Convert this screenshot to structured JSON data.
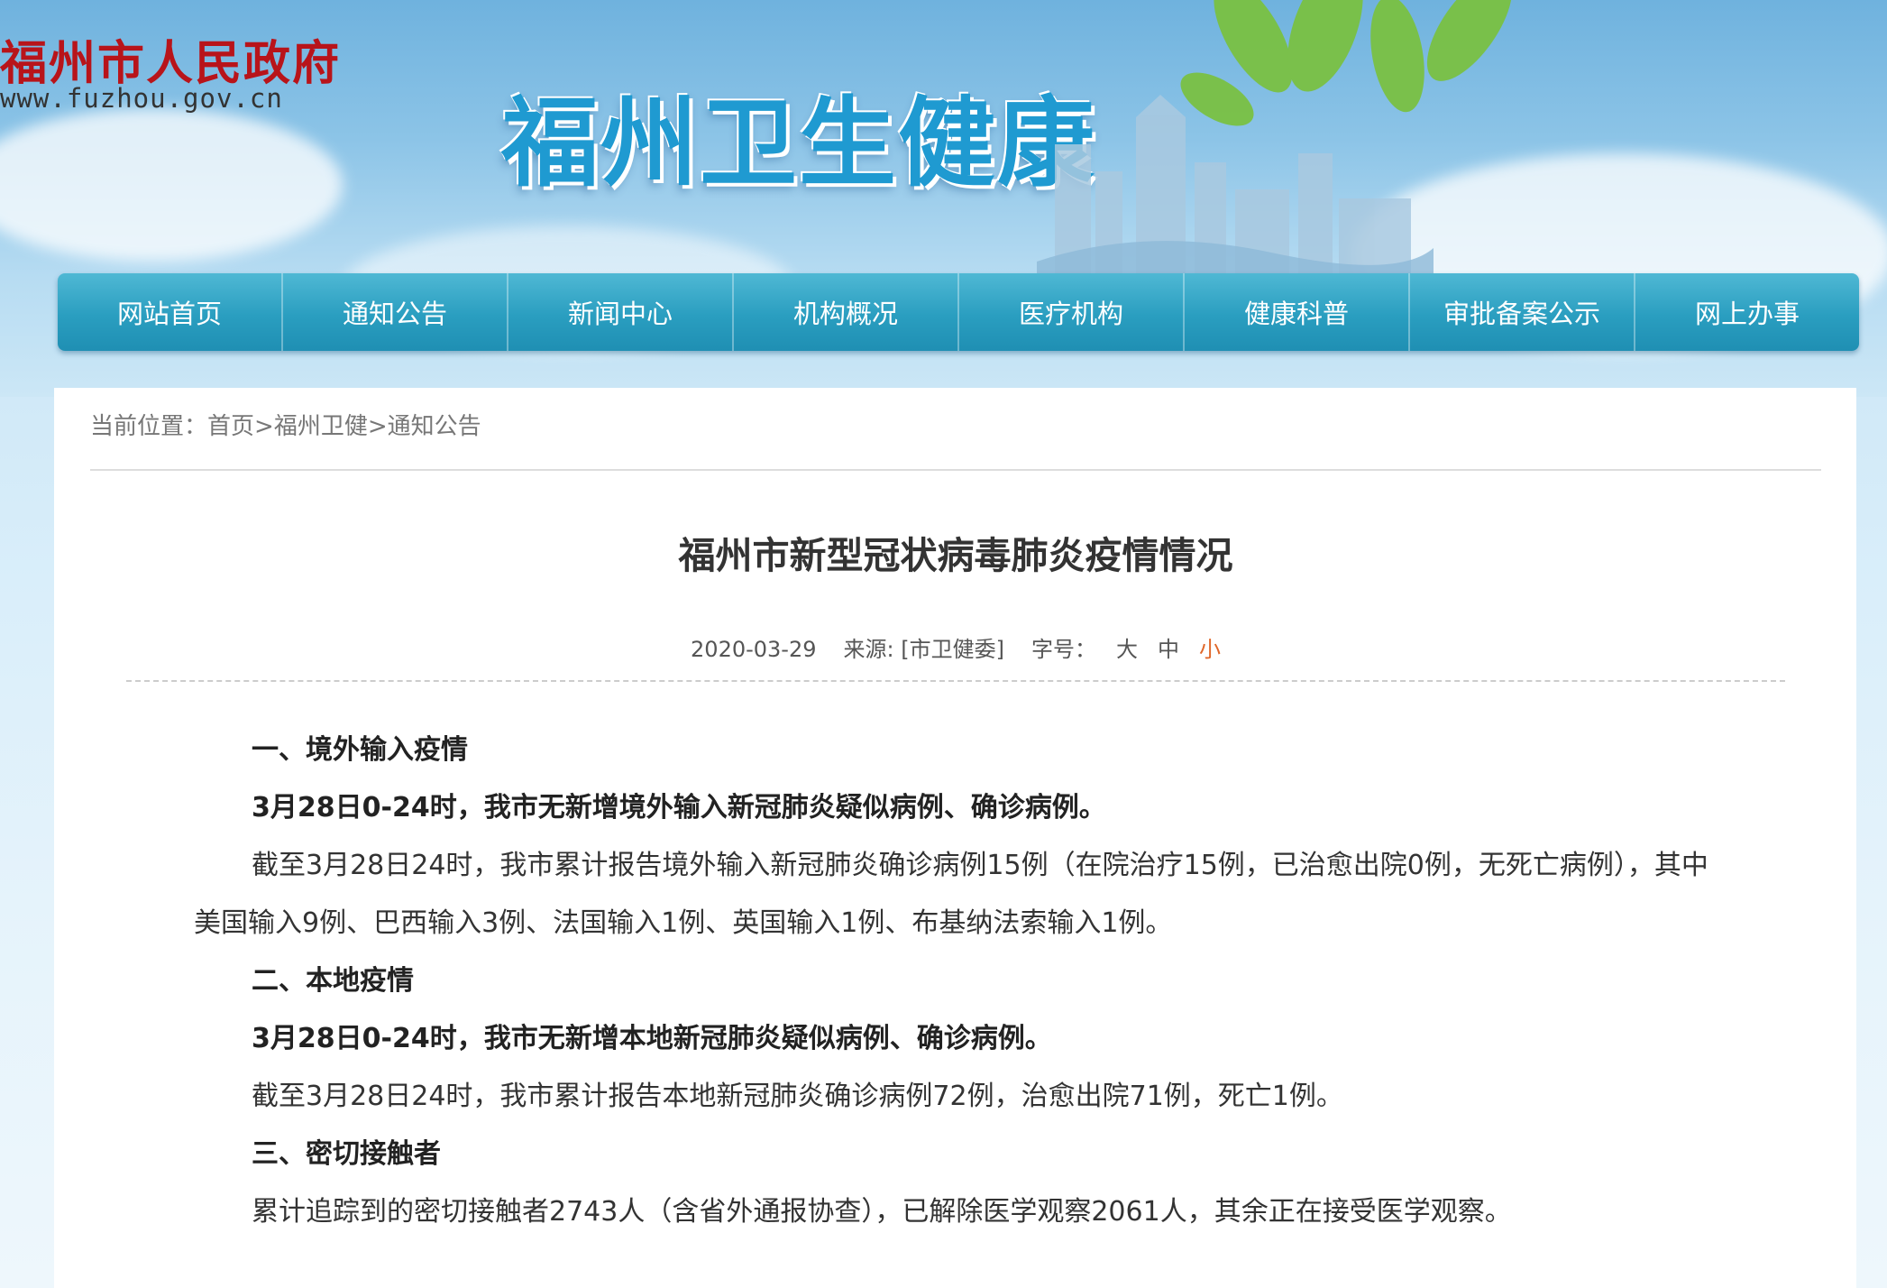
{
  "header": {
    "gov_logo": "福州市人民政府",
    "gov_url": "www.fuzhou.gov.cn",
    "site_title": "福州卫生健康"
  },
  "nav": {
    "items": [
      "网站首页",
      "通知公告",
      "新闻中心",
      "机构概况",
      "医疗机构",
      "健康科普",
      "审批备案公示",
      "网上办事"
    ]
  },
  "breadcrumb": {
    "prefix": "当前位置：",
    "items": [
      "首页",
      "福州卫健",
      "通知公告"
    ],
    "separator": ">"
  },
  "article": {
    "title": "福州市新型冠状病毒肺炎疫情情况",
    "date": "2020-03-29",
    "source": "来源: [市卫健委]",
    "font_size_label": "字号：",
    "font_sizes": [
      "大",
      "中",
      "小"
    ],
    "paragraphs": [
      {
        "bold": true,
        "text": "一、境外输入疫情"
      },
      {
        "bold": true,
        "text": "3月28日0-24时，我市无新增境外输入新冠肺炎疑似病例、确诊病例。"
      },
      {
        "bold": false,
        "text": "截至3月28日24时，我市累计报告境外输入新冠肺炎确诊病例15例（在院治疗15例，已治愈出院0例，无死亡病例），其中美国输入9例、巴西输入3例、法国输入1例、英国输入1例、布基纳法索输入1例。"
      },
      {
        "bold": true,
        "text": "二、本地疫情"
      },
      {
        "bold": true,
        "text": "3月28日0-24时，我市无新增本地新冠肺炎疑似病例、确诊病例。"
      },
      {
        "bold": false,
        "text": "截至3月28日24时，我市累计报告本地新冠肺炎确诊病例72例，治愈出院71例，死亡1例。"
      },
      {
        "bold": true,
        "text": "三、密切接触者"
      },
      {
        "bold": false,
        "text": "累计追踪到的密切接触者2743人（含省外通报协查），已解除医学观察2061人，其余正在接受医学观察。"
      }
    ]
  },
  "colors": {
    "nav_bg": "#2a9ec0",
    "site_title": "#1f9ad1",
    "gov_logo": "#b8141a",
    "active_font_size": "#e0672a"
  }
}
